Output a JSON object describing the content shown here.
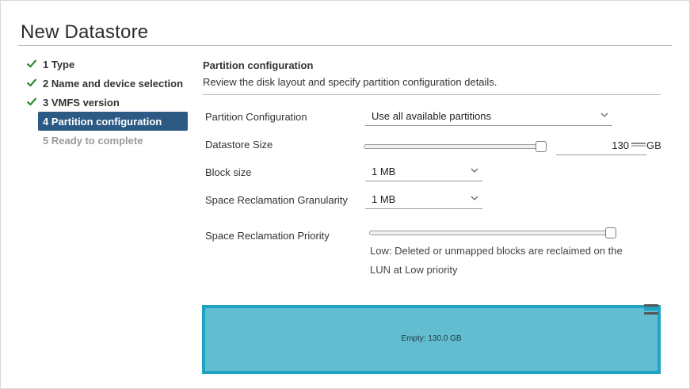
{
  "dialog": {
    "title": "New Datastore"
  },
  "steps": [
    {
      "label": "1 Type",
      "state": "done"
    },
    {
      "label": "2 Name and device selection",
      "state": "done"
    },
    {
      "label": "3 VMFS version",
      "state": "done"
    },
    {
      "label": "4 Partition configuration",
      "state": "active"
    },
    {
      "label": "5 Ready to complete",
      "state": "disabled"
    }
  ],
  "page": {
    "heading": "Partition configuration",
    "description": "Review the disk layout and specify partition configuration details."
  },
  "form": {
    "partition_config": {
      "label": "Partition Configuration",
      "value": "Use all available partitions"
    },
    "datastore_size": {
      "label": "Datastore Size",
      "value": "130",
      "unit": "GB",
      "slider_fraction": 1.0
    },
    "block_size": {
      "label": "Block size",
      "value": "1 MB"
    },
    "reclamation_granularity": {
      "label": "Space Reclamation Granularity",
      "value": "1 MB"
    },
    "reclamation_priority": {
      "label": "Space Reclamation Priority",
      "slider_fraction": 1.0,
      "note": "Low: Deleted or unmapped blocks are reclaimed on the LUN at Low priority"
    }
  },
  "disk_layout": {
    "label": "Empty: 130.0 GB"
  },
  "colors": {
    "active_step": "#2c5a84",
    "check": "#2e8b2e",
    "disk_border": "#1ea3c4",
    "disk_fill": "#62bdd0"
  },
  "icons": {
    "check": "check-icon",
    "chevron": "chevron-down-icon",
    "spin": "spinner-arrows-icon",
    "handle": "resize-handle-icon"
  }
}
